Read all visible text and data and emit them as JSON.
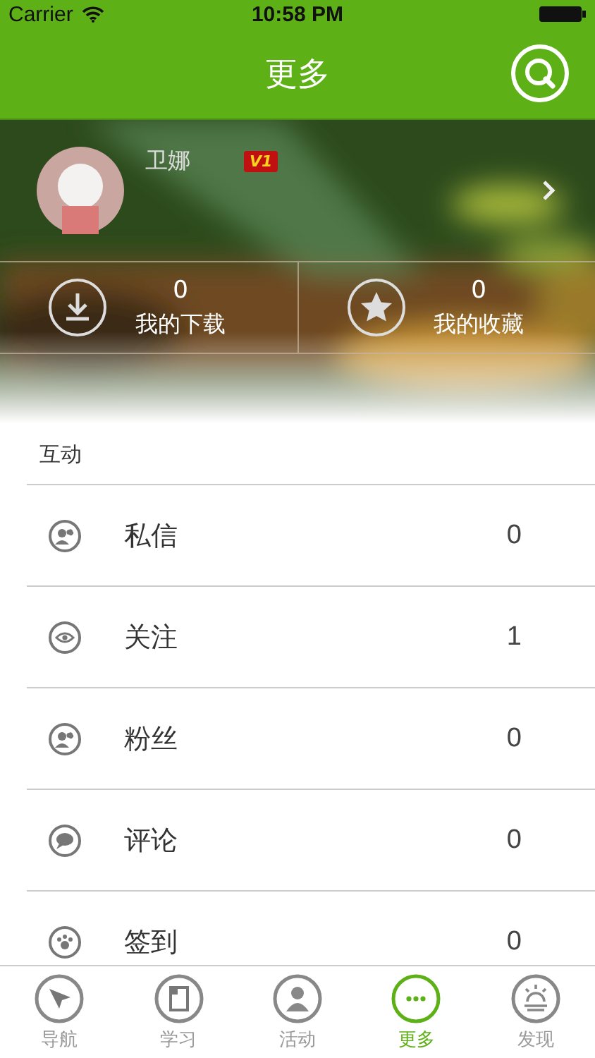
{
  "status_bar": {
    "carrier": "Carrier",
    "time": "10:58 PM"
  },
  "nav_bar": {
    "title": "更多"
  },
  "profile": {
    "name": "卫娜",
    "badge": "V1"
  },
  "stats": [
    {
      "count": "0",
      "label": "我的下载"
    },
    {
      "count": "0",
      "label": "我的收藏"
    }
  ],
  "section": {
    "title": "互动"
  },
  "items": [
    {
      "label": "私信",
      "count": "0"
    },
    {
      "label": "关注",
      "count": "1"
    },
    {
      "label": "粉丝",
      "count": "0"
    },
    {
      "label": "评论",
      "count": "0"
    },
    {
      "label": "签到",
      "count": "0"
    }
  ],
  "tabs": [
    {
      "label": "导航",
      "selected": false
    },
    {
      "label": "学习",
      "selected": false
    },
    {
      "label": "活动",
      "selected": false
    },
    {
      "label": "更多",
      "selected": true
    },
    {
      "label": "发现",
      "selected": false
    }
  ]
}
